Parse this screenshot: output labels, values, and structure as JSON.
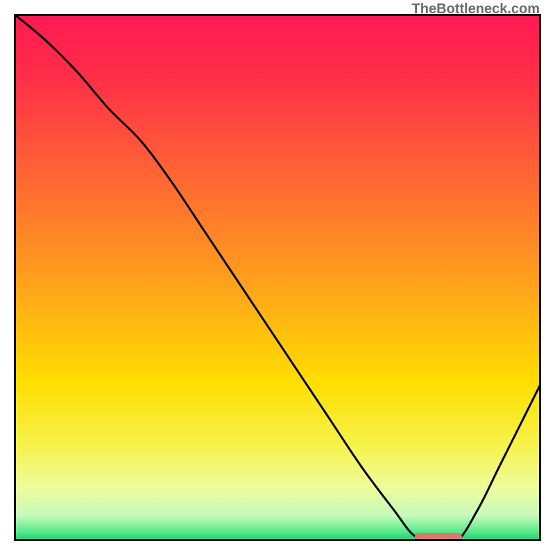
{
  "watermark": "TheBottleneck.com",
  "chart_data": {
    "type": "line",
    "title": "",
    "xlabel": "",
    "ylabel": "",
    "xlim": [
      0,
      100
    ],
    "ylim": [
      0,
      100
    ],
    "gradient_stops": [
      {
        "pos": 0.0,
        "color": "#ff1a52"
      },
      {
        "pos": 0.12,
        "color": "#ff2f48"
      },
      {
        "pos": 0.28,
        "color": "#ff5e36"
      },
      {
        "pos": 0.44,
        "color": "#ff8c24"
      },
      {
        "pos": 0.58,
        "color": "#ffb712"
      },
      {
        "pos": 0.7,
        "color": "#ffde00"
      },
      {
        "pos": 0.82,
        "color": "#f7f24a"
      },
      {
        "pos": 0.9,
        "color": "#eefc9a"
      },
      {
        "pos": 0.955,
        "color": "#c6fbbc"
      },
      {
        "pos": 0.985,
        "color": "#5beb8c"
      },
      {
        "pos": 1.0,
        "color": "#21d27a"
      }
    ],
    "series": [
      {
        "name": "bottleneck-curve",
        "x": [
          0,
          6,
          12,
          18,
          24,
          30,
          36,
          42,
          48,
          54,
          60,
          66,
          72,
          76,
          80,
          84,
          88,
          92,
          96,
          100
        ],
        "y": [
          100,
          95,
          89,
          82,
          76,
          68,
          59,
          50,
          41,
          32,
          23,
          14,
          6,
          1,
          0,
          0,
          6,
          14,
          22,
          30
        ]
      }
    ],
    "marker": {
      "name": "highlight-strip",
      "x_start": 76,
      "x_end": 85,
      "y": 0.8,
      "height": 1.6,
      "color": "#d9786b"
    }
  }
}
